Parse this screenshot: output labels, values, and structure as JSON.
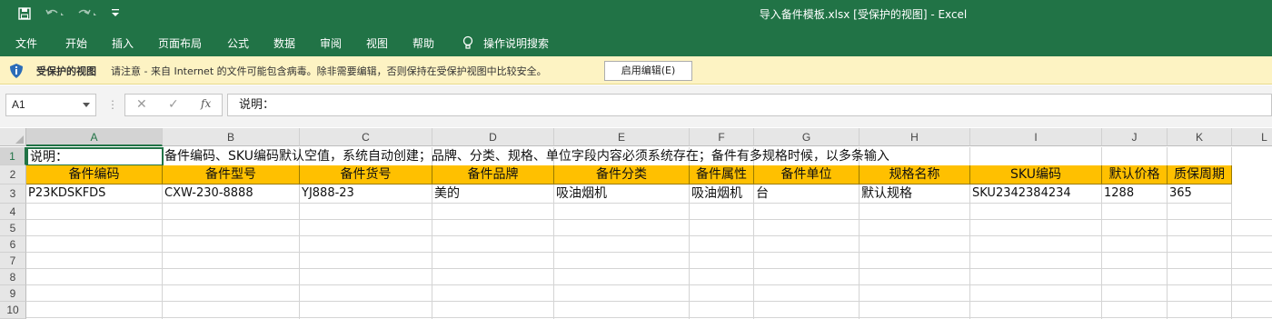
{
  "window": {
    "title": "导入备件模板.xlsx  [受保护的视图]   -   Excel"
  },
  "quick_access": {
    "icons": [
      "save-icon",
      "undo-icon",
      "redo-icon",
      "customize-icon"
    ]
  },
  "ribbon": {
    "tabs": [
      "文件",
      "开始",
      "插入",
      "页面布局",
      "公式",
      "数据",
      "审阅",
      "视图",
      "帮助"
    ],
    "tell_me": "操作说明搜索"
  },
  "protected_view": {
    "title": "受保护的视图",
    "message": "请注意 - 来自 Internet 的文件可能包含病毒。除非需要编辑，否则保持在受保护视图中比较安全。",
    "enable_button": "启用编辑(E)"
  },
  "formula_bar": {
    "name_box": "A1",
    "formula": "说明："
  },
  "sheet": {
    "columns": [
      "A",
      "B",
      "C",
      "D",
      "E",
      "F",
      "G",
      "H",
      "I",
      "J",
      "K",
      "L"
    ],
    "rows": [
      "1",
      "2",
      "3",
      "4",
      "5",
      "6",
      "7",
      "8",
      "9",
      "10"
    ],
    "row1": {
      "a1": "说明：",
      "b1": "备件编码、SKU编码默认空值，系统自动创建；品牌、分类、规格、单位字段内容必须系统存在；备件有多规格时候，以多条输入"
    },
    "headers": [
      "备件编码",
      "备件型号",
      "备件货号",
      "备件品牌",
      "备件分类",
      "备件属性",
      "备件单位",
      "规格名称",
      "SKU编码",
      "默认价格",
      "质保周期"
    ],
    "data_row": [
      "P23KDSKFDS",
      "CXW-230-8888",
      "YJ888-23",
      "美的",
      "吸油烟机",
      "吸油烟机",
      "台",
      "默认规格",
      "SKU2342384234",
      "1288",
      "365"
    ],
    "header_fill": "#ffc000"
  },
  "colors": {
    "excel_green": "#217346",
    "protected_bar": "#fdf3c3"
  }
}
